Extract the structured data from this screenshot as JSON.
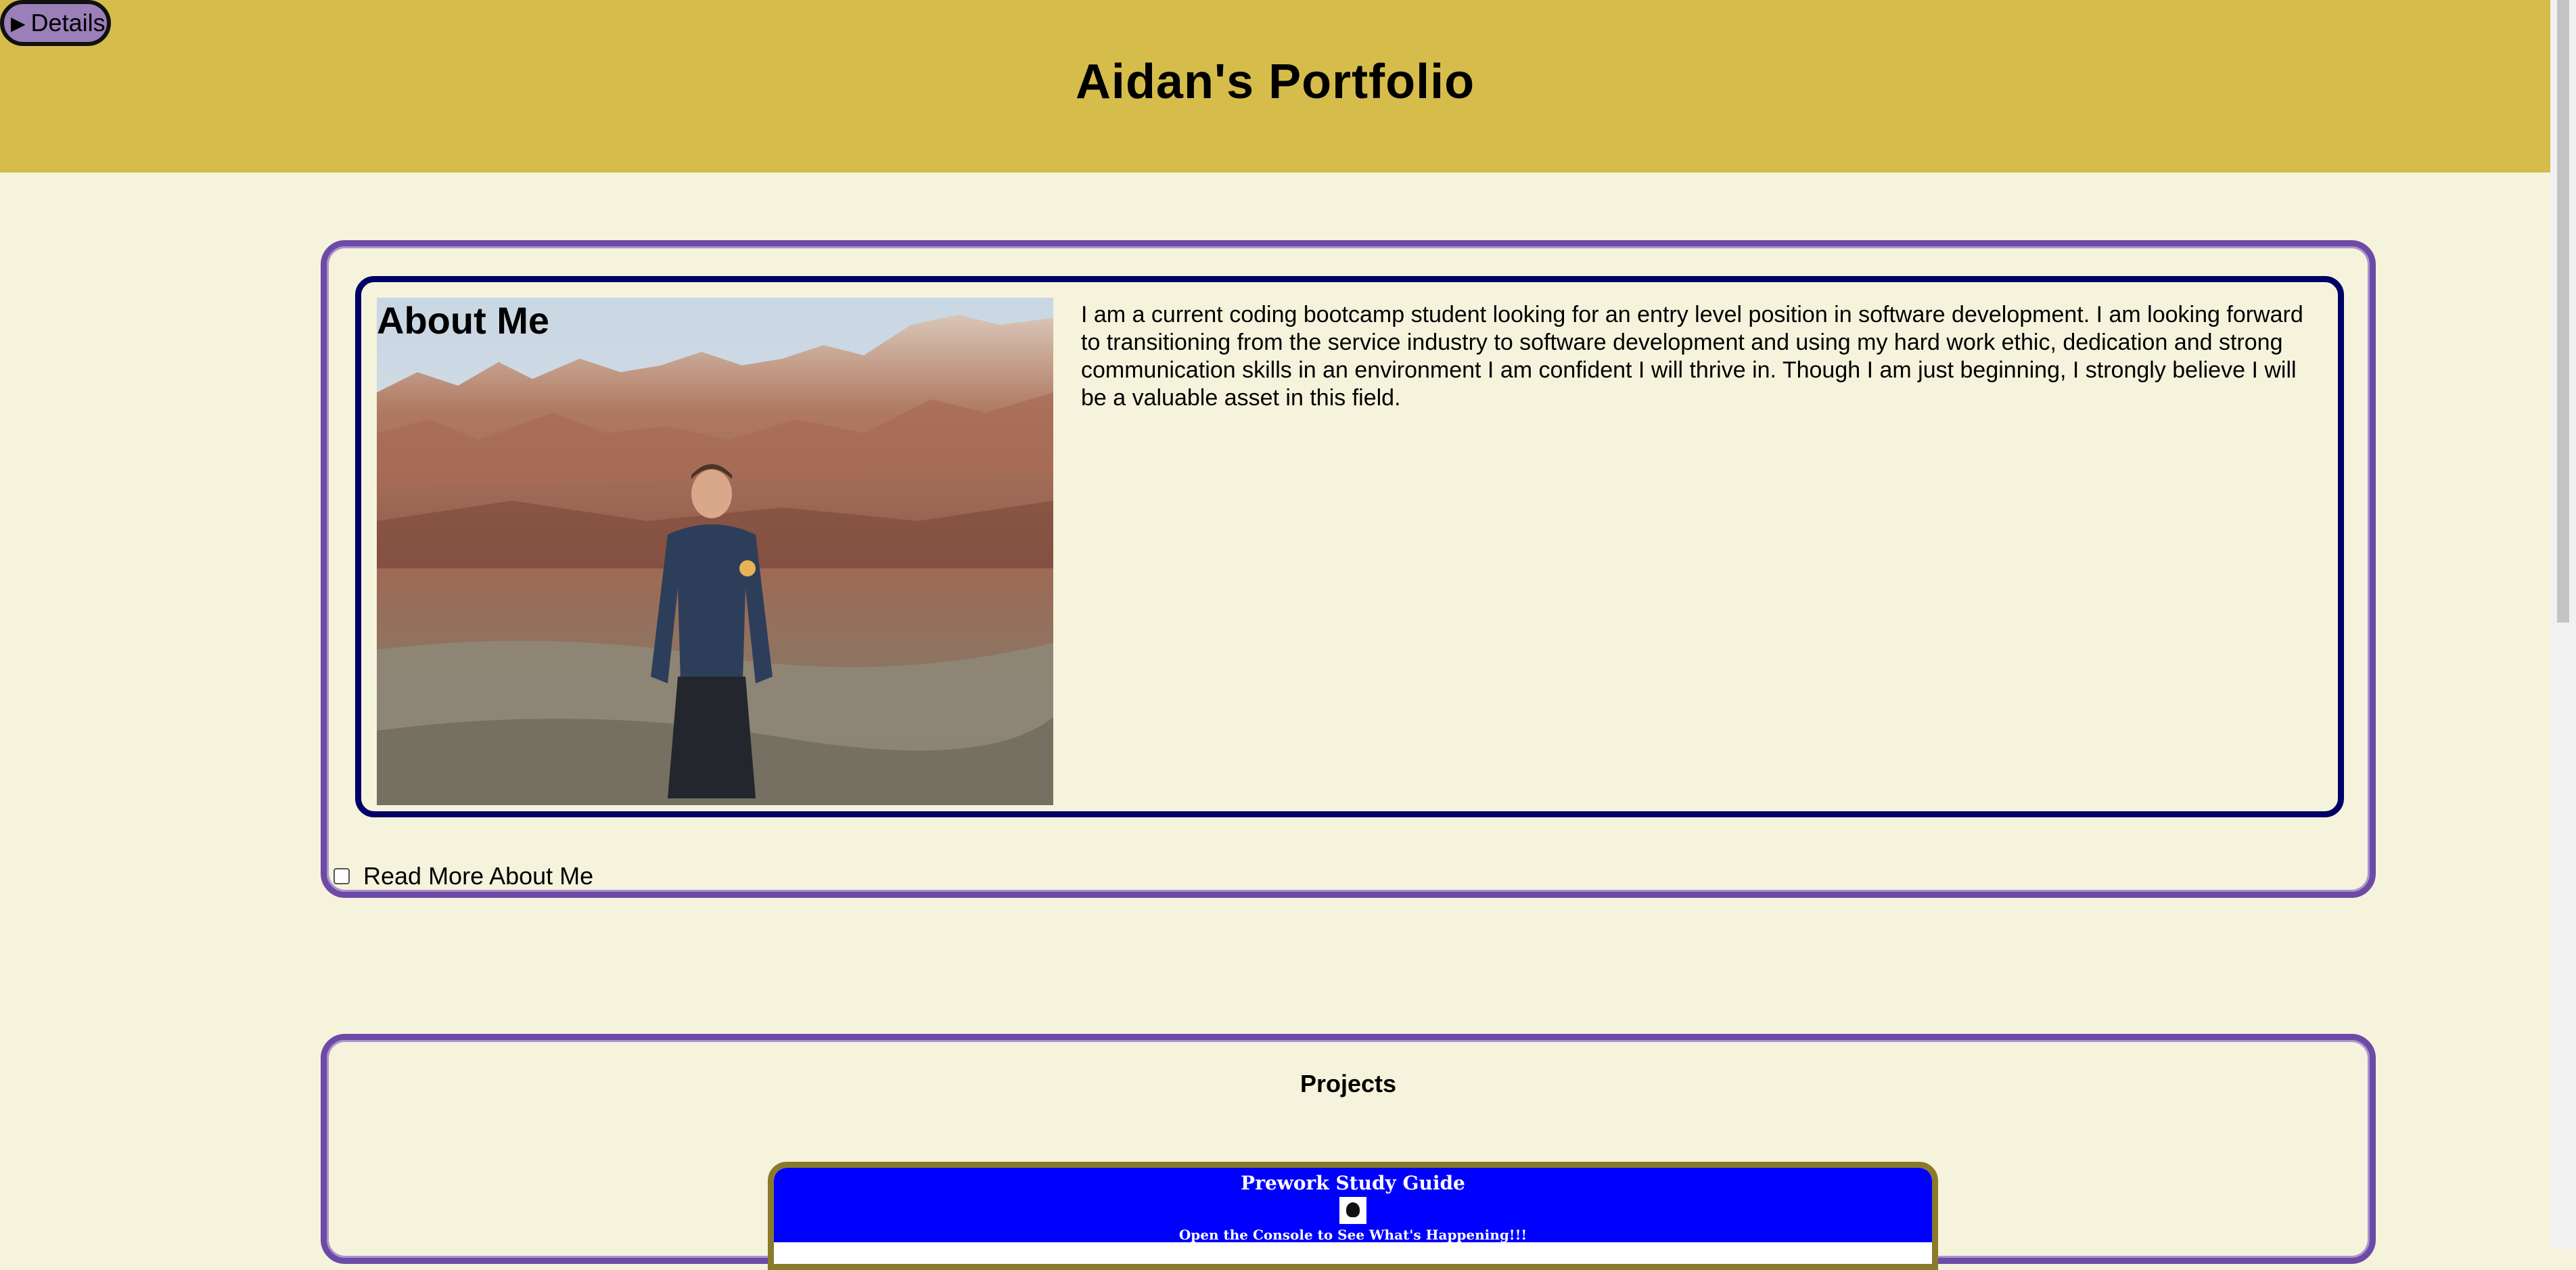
{
  "header": {
    "details_label": "Details",
    "title": "Aidan's Portfolio"
  },
  "about": {
    "title": "About Me",
    "text": "I am a current coding bootcamp student looking for an entry level position in software development. I am looking forward to transitioning from the service industry to software development and using my hard work ethic, dedication and strong communication skills in an environment I am confident I will thrive in. Though I am just beginning, I strongly believe I will be a valuable asset in this field.",
    "read_more_label": "Read More About Me",
    "read_more_checked": false
  },
  "projects": {
    "title": "Projects",
    "cards": [
      {
        "name": "Prework Study Guide",
        "subtitle": "Open the Console to See What's Happening!!!"
      }
    ]
  },
  "colors": {
    "header_bg": "#d6bd4b",
    "page_bg": "#f5f3dc",
    "section_border": "#6d4aa6",
    "about_border": "#000066",
    "details_button_bg": "#9a7fb8",
    "project_banner": "#0000ff",
    "project_border": "#8a7a2a"
  }
}
